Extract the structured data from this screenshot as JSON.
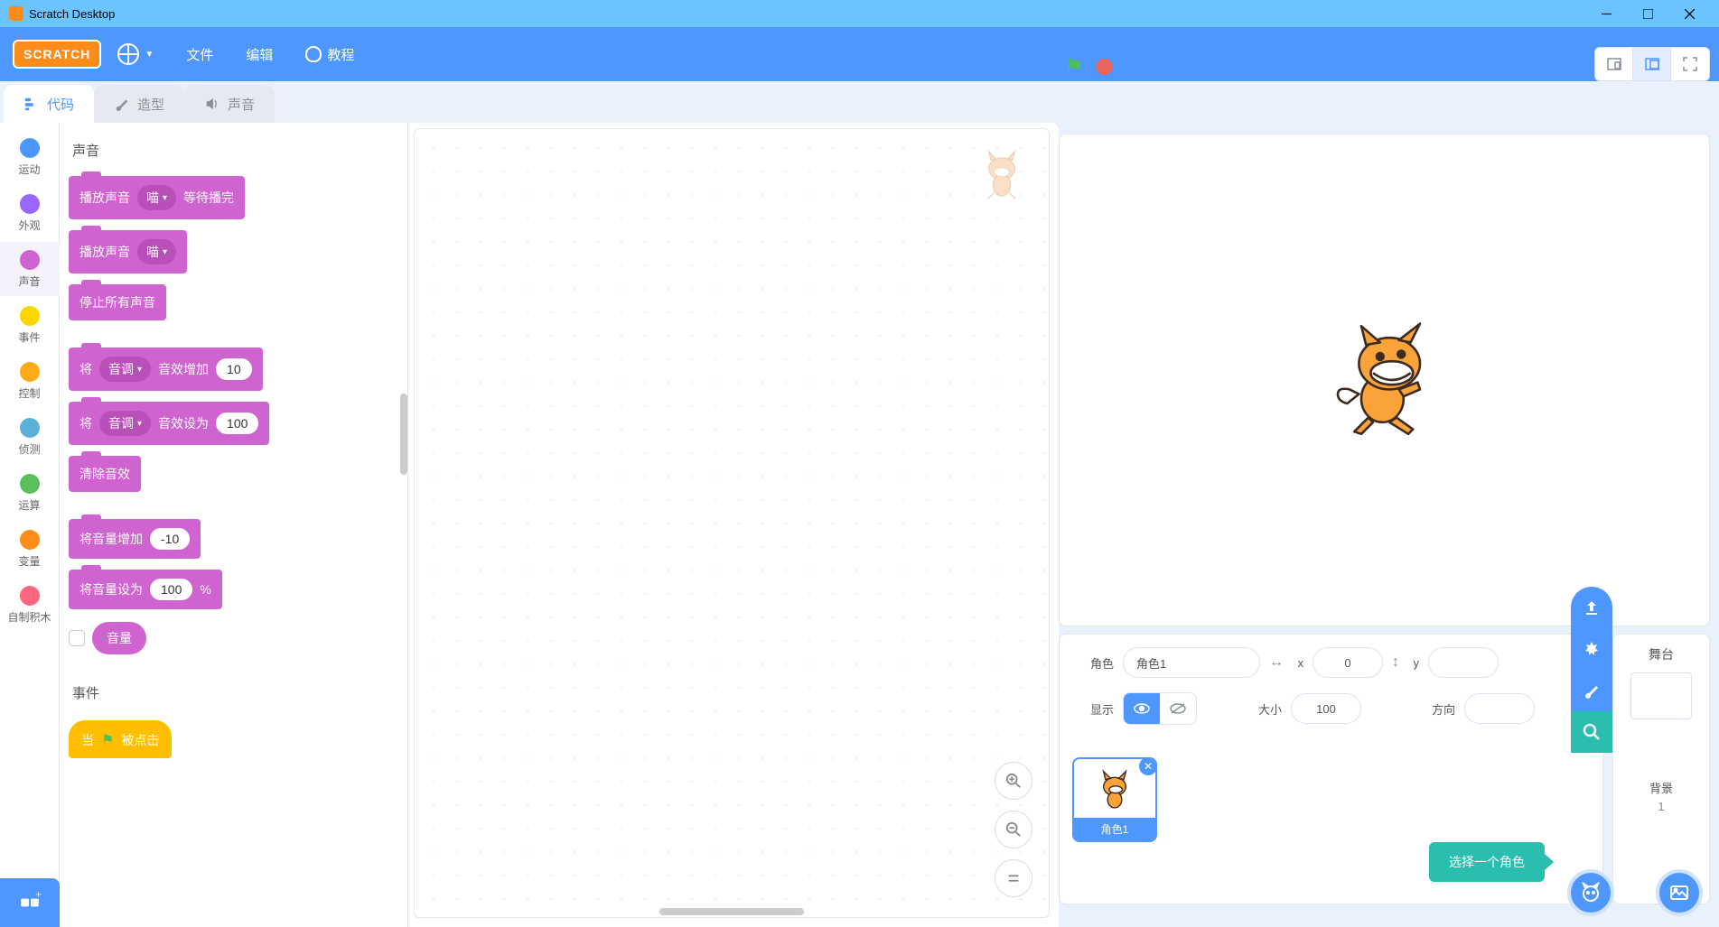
{
  "window": {
    "title": "Scratch Desktop"
  },
  "menubar": {
    "logo": "SCRATCH",
    "file": "文件",
    "edit": "编辑",
    "tutorials": "教程"
  },
  "tabs": {
    "code": "代码",
    "costumes": "造型",
    "sounds": "声音"
  },
  "categories": [
    {
      "label": "运动",
      "color": "#4c97ff"
    },
    {
      "label": "外观",
      "color": "#9966ff"
    },
    {
      "label": "声音",
      "color": "#cf63cf",
      "active": true
    },
    {
      "label": "事件",
      "color": "#ffd500"
    },
    {
      "label": "控制",
      "color": "#ffab19"
    },
    {
      "label": "侦测",
      "color": "#5cb1d6"
    },
    {
      "label": "运算",
      "color": "#59c059"
    },
    {
      "label": "变量",
      "color": "#ff8c1a"
    },
    {
      "label": "自制积木",
      "color": "#ff6680"
    }
  ],
  "palette": {
    "heading_sound": "声音",
    "heading_events": "事件",
    "b1_a": "播放声音",
    "b1_dd": "喵",
    "b1_b": "等待播完",
    "b2_a": "播放声音",
    "b2_dd": "喵",
    "b3": "停止所有声音",
    "b4_a": "将",
    "b4_dd": "音调",
    "b4_b": "音效增加",
    "b4_n": "10",
    "b5_a": "将",
    "b5_dd": "音调",
    "b5_b": "音效设为",
    "b5_n": "100",
    "b6": "清除音效",
    "b7_a": "将音量增加",
    "b7_n": "-10",
    "b8_a": "将音量设为",
    "b8_n": "100",
    "b8_b": "%",
    "reporter_vol": "音量",
    "hat_a": "当",
    "hat_b": "被点击"
  },
  "sprite_info": {
    "label_sprite": "角色",
    "name": "角色1",
    "label_x": "x",
    "x": "0",
    "label_y": "y",
    "y": "",
    "label_show": "显示",
    "label_size": "大小",
    "size": "100",
    "label_direction": "方向",
    "direction": "",
    "choose": "选择一个角色",
    "tile_caption": "角色1"
  },
  "backdrop": {
    "title": "舞台",
    "label": "背景",
    "count": "1"
  }
}
